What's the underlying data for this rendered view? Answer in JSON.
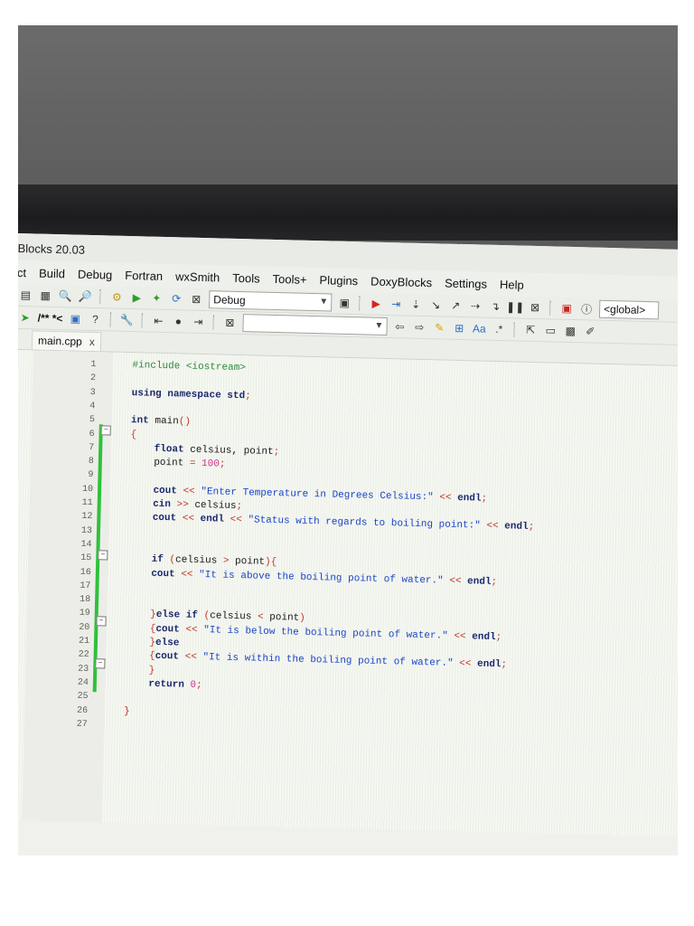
{
  "window": {
    "title": "Blocks 20.03"
  },
  "menu": [
    "ct",
    "Build",
    "Debug",
    "Fortran",
    "wxSmith",
    "Tools",
    "Tools+",
    "Plugins",
    "DoxyBlocks",
    "Settings",
    "Help"
  ],
  "toolbar": {
    "build_target": "Debug",
    "scope_combo": "<global>",
    "search_combo": ""
  },
  "toolbar2_text": "/** *<",
  "tab": {
    "label": "main.cpp",
    "close": "x"
  },
  "editor": {
    "line_numbers": [
      "1",
      "2",
      "3",
      "4",
      "5",
      "6",
      "7",
      "8",
      "9",
      "10",
      "11",
      "12",
      "13",
      "14",
      "15",
      "16",
      "17",
      "18",
      "19",
      "20",
      "21",
      "22",
      "23",
      "24",
      "25",
      "26",
      "27"
    ],
    "lines": [
      "#include <iostream>",
      "",
      "using namespace std;",
      "",
      "int main()",
      "{",
      "    float celsius, point;",
      "    point = 100;",
      "",
      "    cout << \"Enter Temperature in Degrees Celsius:\" << endl;",
      "    cin >> celsius;",
      "    cout << endl << \"Status with regards to boiling point:\" << endl;",
      "",
      "    if (celsius > point){",
      "    cout << \"It is above the boiling point of water.\" << endl;",
      "",
      "    }else if (celsius < point)",
      "    {cout << \"It is below the boiling point of water.\" << endl;",
      "    }else",
      "    {cout << \"It is within the boiling point of water.\" << endl;",
      "    }",
      "    return 0;",
      "}"
    ]
  },
  "colors": {
    "keyword": "#1c2a6e",
    "preprocessor": "#2e8b3a",
    "string": "#1b46c9",
    "number": "#d0368a",
    "changebar": "#2fc13a"
  }
}
